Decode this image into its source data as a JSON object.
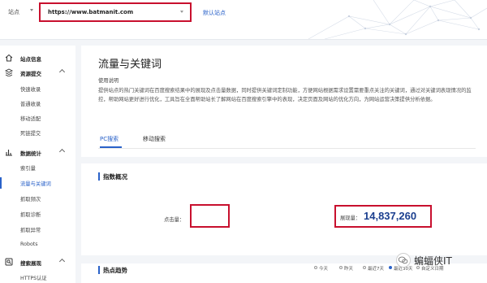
{
  "header": {
    "site_label": "站点",
    "site_url": "https://www.batmanit.com",
    "default_site": "默认站点"
  },
  "sidebar": {
    "groups": [
      {
        "label": "站点信息",
        "icon": "home-icon",
        "items": []
      },
      {
        "label": "资源提交",
        "icon": "submit-icon",
        "items": [
          "快速收录",
          "普通收录",
          "移动适配",
          "死链提交"
        ]
      },
      {
        "label": "数据统计",
        "icon": "stats-icon",
        "items": [
          "索引量",
          "流量与关键词",
          "抓取频次",
          "抓取诊断",
          "抓取异常",
          "Robots"
        ]
      },
      {
        "label": "搜索展现",
        "icon": "search-display-icon",
        "items": [
          "HTTPS认证"
        ]
      }
    ],
    "active_item": "流量与关键词"
  },
  "main": {
    "title": "流量与关键词",
    "usage_title": "使用说明",
    "usage_text": "提供站点的热门关键词在百度搜索结果中的展现及点击量数据，同时提供关键词定制功能，方便网站根据需求设置需要重点关注的关键词，通过对关键词表现情况的监控，帮助网站更好进行优化，工具旨在全面帮助站长了解网站在百度搜索引擎中的表现，决定页面及网站的优化方向，为网站运营决策提供分析依据。",
    "tabs": [
      "PC搜索",
      "移动搜索"
    ],
    "active_tab": "PC搜索",
    "overview": {
      "title": "指数概况",
      "click_label": "点击量：",
      "click_value": "",
      "show_label": "展现量：",
      "show_value": "14,837,260"
    },
    "trend": {
      "title": "热点趋势",
      "ranges": [
        "今天",
        "昨天",
        "最近7天",
        "最近30天",
        "自定义日期"
      ],
      "selected_range": "最近30天"
    }
  },
  "watermark": {
    "text": "蝙蝠侠IT"
  },
  "colors": {
    "accent": "#2a62c9",
    "highlight_border": "#c8102e",
    "value_text": "#1b3f8f"
  }
}
